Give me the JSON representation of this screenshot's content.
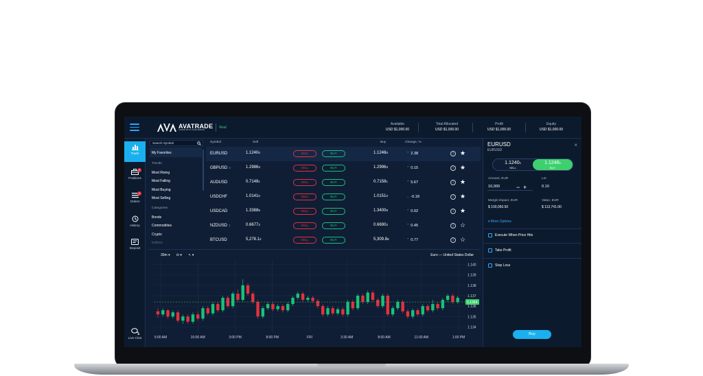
{
  "header": {
    "logo_name": "AVATRADE",
    "logo_tagline": "TRADE WITH CONFIDENCE",
    "account_mode": "Real",
    "stats": [
      {
        "label": "Available",
        "value": "USD $1,000.00"
      },
      {
        "label": "Total Allocated",
        "value": "USD $1,000.00"
      },
      {
        "label": "Profit",
        "value": "USD $1,000.00"
      },
      {
        "label": "Equity",
        "value": "USD $1,000.00"
      }
    ]
  },
  "leftnav": {
    "items": [
      {
        "label": "Trade",
        "icon": "bar-chart-icon",
        "active": true
      },
      {
        "label": "Positions",
        "icon": "briefcase-icon",
        "badge": "2"
      },
      {
        "label": "Orders",
        "icon": "list-icon",
        "badge": "1"
      },
      {
        "label": "History",
        "icon": "history-icon"
      },
      {
        "label": "Deposit",
        "icon": "wallet-icon"
      }
    ],
    "live_chat": "Live Chat"
  },
  "categories": {
    "search_placeholder": "Search Symbol",
    "favorites": "My Favorites",
    "trends_heading": "Trends",
    "trends": [
      "Most Rising",
      "Most Falling",
      "Most Buying",
      "Most Selling"
    ],
    "categories_heading": "Categories",
    "categories": [
      "Bonds",
      "Commodities",
      "Crypto",
      "Indices"
    ]
  },
  "table": {
    "columns": {
      "symbol": "Symbol",
      "sell": "Sell",
      "buy": "Buy",
      "change": "Change, %"
    },
    "sell_label": "SELL",
    "buy_label": "BUY",
    "rows": [
      {
        "symbol": "EURUSD",
        "badge": "",
        "sell_main": "1.1240",
        "sell_pip": "0",
        "buy_main": "1.1248",
        "buy_pip": "0",
        "change": "2.38",
        "dir": "up",
        "fav": true
      },
      {
        "symbol": "GBPUSD",
        "badge": "2",
        "sell_main": "1.2986",
        "sell_pip": "3",
        "buy_main": "1.2996",
        "buy_pip": "3",
        "change": "0.15",
        "dir": "up",
        "fav": true
      },
      {
        "symbol": "AUDUSD",
        "badge": "",
        "sell_main": "0.7148",
        "sell_pip": "1",
        "buy_main": "0.7158",
        "buy_pip": "1",
        "change": "5.67",
        "dir": "up",
        "fav": true
      },
      {
        "symbol": "USDCHF",
        "badge": "",
        "sell_main": "1.0141",
        "sell_pip": "0",
        "buy_main": "1.0151",
        "buy_pip": "0",
        "change": "-0.18",
        "dir": "down",
        "fav": true
      },
      {
        "symbol": "USDCAD",
        "badge": "",
        "sell_main": "1.3388",
        "sell_pip": "9",
        "buy_main": "1.3400",
        "buy_pip": "9",
        "change": "0.02",
        "dir": "up",
        "fav": true
      },
      {
        "symbol": "NZDUSD",
        "badge": "1",
        "sell_main": "0.6677",
        "sell_pip": "2",
        "buy_main": "0.6690",
        "buy_pip": "2",
        "change": "0.45",
        "dir": "up",
        "fav": false
      },
      {
        "symbol": "BTCUSD",
        "badge": "",
        "sell_main": "5,278.1",
        "sell_pip": "2",
        "buy_main": "5,309.8",
        "buy_pip": "8",
        "change": "0.77",
        "dir": "up",
        "fav": false
      }
    ]
  },
  "chart": {
    "timeframe": "30m",
    "title": "Euro — United States Dollar",
    "current_price": "1.1364",
    "y_ticks": [
      "1.140",
      "1.139",
      "1.138",
      "1.137",
      "1.136",
      "1.135",
      "1.134"
    ],
    "x_ticks": [
      "5:00 AM",
      "10:00 AM",
      "3:00 PM",
      "8:00 PM",
      "FRI",
      "3:30 AM",
      "8:00 AM",
      "11:00 AM",
      "1:00 PM"
    ]
  },
  "chart_data": {
    "type": "candlestick",
    "title": "Euro — United States Dollar",
    "ylim": [
      1.1335,
      1.1405
    ],
    "y_ticks": [
      1.14,
      1.139,
      1.138,
      1.137,
      1.136,
      1.135,
      1.134
    ],
    "x_ticks": [
      "5:00 AM",
      "10:00 AM",
      "3:00 PM",
      "8:00 PM",
      "FRI",
      "3:30 AM",
      "8:00 AM",
      "11:00 AM",
      "1:00 PM"
    ],
    "candles": [
      {
        "o": 1.1355,
        "c": 1.1352,
        "h": 1.1358,
        "l": 1.1349
      },
      {
        "o": 1.1352,
        "c": 1.1356,
        "h": 1.1358,
        "l": 1.135
      },
      {
        "o": 1.1356,
        "c": 1.135,
        "h": 1.1357,
        "l": 1.1348
      },
      {
        "o": 1.135,
        "c": 1.1354,
        "h": 1.1356,
        "l": 1.1348
      },
      {
        "o": 1.1354,
        "c": 1.1346,
        "h": 1.1356,
        "l": 1.1344
      },
      {
        "o": 1.1346,
        "c": 1.135,
        "h": 1.1352,
        "l": 1.1343
      },
      {
        "o": 1.135,
        "c": 1.1345,
        "h": 1.1352,
        "l": 1.1343
      },
      {
        "o": 1.1345,
        "c": 1.1352,
        "h": 1.1354,
        "l": 1.1343
      },
      {
        "o": 1.1352,
        "c": 1.1348,
        "h": 1.1355,
        "l": 1.1346
      },
      {
        "o": 1.1348,
        "c": 1.1358,
        "h": 1.136,
        "l": 1.1346
      },
      {
        "o": 1.1358,
        "c": 1.1353,
        "h": 1.136,
        "l": 1.1351
      },
      {
        "o": 1.1353,
        "c": 1.1362,
        "h": 1.1364,
        "l": 1.1351
      },
      {
        "o": 1.1362,
        "c": 1.1356,
        "h": 1.1364,
        "l": 1.1354
      },
      {
        "o": 1.1356,
        "c": 1.1368,
        "h": 1.137,
        "l": 1.1354
      },
      {
        "o": 1.1368,
        "c": 1.136,
        "h": 1.137,
        "l": 1.1358
      },
      {
        "o": 1.136,
        "c": 1.1372,
        "h": 1.1374,
        "l": 1.1358
      },
      {
        "o": 1.1372,
        "c": 1.1366,
        "h": 1.1376,
        "l": 1.1364
      },
      {
        "o": 1.1366,
        "c": 1.138,
        "h": 1.1386,
        "l": 1.1364
      },
      {
        "o": 1.138,
        "c": 1.1372,
        "h": 1.1382,
        "l": 1.137
      },
      {
        "o": 1.1372,
        "c": 1.1364,
        "h": 1.1374,
        "l": 1.1362
      },
      {
        "o": 1.1364,
        "c": 1.135,
        "h": 1.1366,
        "l": 1.1348
      },
      {
        "o": 1.135,
        "c": 1.1358,
        "h": 1.136,
        "l": 1.1348
      },
      {
        "o": 1.1358,
        "c": 1.1362,
        "h": 1.1364,
        "l": 1.1356
      },
      {
        "o": 1.1362,
        "c": 1.1357,
        "h": 1.1364,
        "l": 1.1355
      },
      {
        "o": 1.1357,
        "c": 1.136,
        "h": 1.1362,
        "l": 1.1355
      },
      {
        "o": 1.136,
        "c": 1.1356,
        "h": 1.1362,
        "l": 1.1354
      },
      {
        "o": 1.1356,
        "c": 1.1362,
        "h": 1.1364,
        "l": 1.1354
      },
      {
        "o": 1.1362,
        "c": 1.1368,
        "h": 1.137,
        "l": 1.136
      },
      {
        "o": 1.1368,
        "c": 1.1372,
        "h": 1.1374,
        "l": 1.1366
      },
      {
        "o": 1.1372,
        "c": 1.1366,
        "h": 1.1374,
        "l": 1.1364
      },
      {
        "o": 1.1366,
        "c": 1.1368,
        "h": 1.137,
        "l": 1.1364
      },
      {
        "o": 1.1368,
        "c": 1.1365,
        "h": 1.137,
        "l": 1.1363
      },
      {
        "o": 1.1365,
        "c": 1.136,
        "h": 1.1367,
        "l": 1.1358
      },
      {
        "o": 1.136,
        "c": 1.1352,
        "h": 1.1362,
        "l": 1.135
      },
      {
        "o": 1.1352,
        "c": 1.1358,
        "h": 1.136,
        "l": 1.135
      },
      {
        "o": 1.1358,
        "c": 1.1353,
        "h": 1.136,
        "l": 1.1351
      },
      {
        "o": 1.1353,
        "c": 1.1357,
        "h": 1.1359,
        "l": 1.1351
      },
      {
        "o": 1.1357,
        "c": 1.1352,
        "h": 1.1359,
        "l": 1.135
      },
      {
        "o": 1.1352,
        "c": 1.1364,
        "h": 1.1366,
        "l": 1.135
      },
      {
        "o": 1.1364,
        "c": 1.1358,
        "h": 1.1366,
        "l": 1.1356
      },
      {
        "o": 1.1358,
        "c": 1.137,
        "h": 1.1372,
        "l": 1.1356
      },
      {
        "o": 1.137,
        "c": 1.1364,
        "h": 1.1372,
        "l": 1.1362
      },
      {
        "o": 1.1364,
        "c": 1.1373,
        "h": 1.1375,
        "l": 1.1362
      },
      {
        "o": 1.1373,
        "c": 1.1366,
        "h": 1.1375,
        "l": 1.1364
      },
      {
        "o": 1.1366,
        "c": 1.136,
        "h": 1.1368,
        "l": 1.1358
      },
      {
        "o": 1.136,
        "c": 1.137,
        "h": 1.1372,
        "l": 1.1358
      },
      {
        "o": 1.137,
        "c": 1.1352,
        "h": 1.1372,
        "l": 1.135
      },
      {
        "o": 1.1352,
        "c": 1.1358,
        "h": 1.136,
        "l": 1.135
      },
      {
        "o": 1.1358,
        "c": 1.1364,
        "h": 1.1366,
        "l": 1.1356
      },
      {
        "o": 1.1364,
        "c": 1.1355,
        "h": 1.1366,
        "l": 1.1353
      },
      {
        "o": 1.1355,
        "c": 1.135,
        "h": 1.1357,
        "l": 1.1348
      },
      {
        "o": 1.135,
        "c": 1.1356,
        "h": 1.1358,
        "l": 1.1348
      },
      {
        "o": 1.1356,
        "c": 1.1352,
        "h": 1.1358,
        "l": 1.135
      },
      {
        "o": 1.1352,
        "c": 1.136,
        "h": 1.1362,
        "l": 1.135
      },
      {
        "o": 1.136,
        "c": 1.1356,
        "h": 1.1362,
        "l": 1.1354
      },
      {
        "o": 1.1356,
        "c": 1.1362,
        "h": 1.1366,
        "l": 1.1354
      },
      {
        "o": 1.1362,
        "c": 1.1358,
        "h": 1.1364,
        "l": 1.1356
      },
      {
        "o": 1.1358,
        "c": 1.1366,
        "h": 1.1368,
        "l": 1.1356
      },
      {
        "o": 1.1366,
        "c": 1.137,
        "h": 1.1372,
        "l": 1.1364
      },
      {
        "o": 1.137,
        "c": 1.1364,
        "h": 1.1372,
        "l": 1.1362
      },
      {
        "o": 1.1364,
        "c": 1.1368,
        "h": 1.137,
        "l": 1.1362
      }
    ]
  },
  "order_panel": {
    "symbol": "EURUSD",
    "subtitle": "EURUSD",
    "sell_price": "1.1240",
    "sell_pip": "0",
    "sell_label": "SELL",
    "buy_price": "1.1248",
    "buy_pip": "0",
    "buy_label": "BUY",
    "amount_label": "Amount, EUR",
    "amount_value": "10,000",
    "lot_label": "Lot",
    "lot_value": "0.10",
    "margin_label": "Margin impact, EUR",
    "margin_value": "$ 100,050.50",
    "value_label": "Value, EUR",
    "value_value": "$ 113,741.00",
    "more_options": "More Options",
    "options": [
      "Execute When Price Hits",
      "Take Profit",
      "Stop Loss"
    ],
    "cta": "Buy"
  },
  "colors": {
    "bg": "#0f1e35",
    "accent": "#1ab0ef",
    "up": "#19c27a",
    "down": "#e2323e"
  }
}
